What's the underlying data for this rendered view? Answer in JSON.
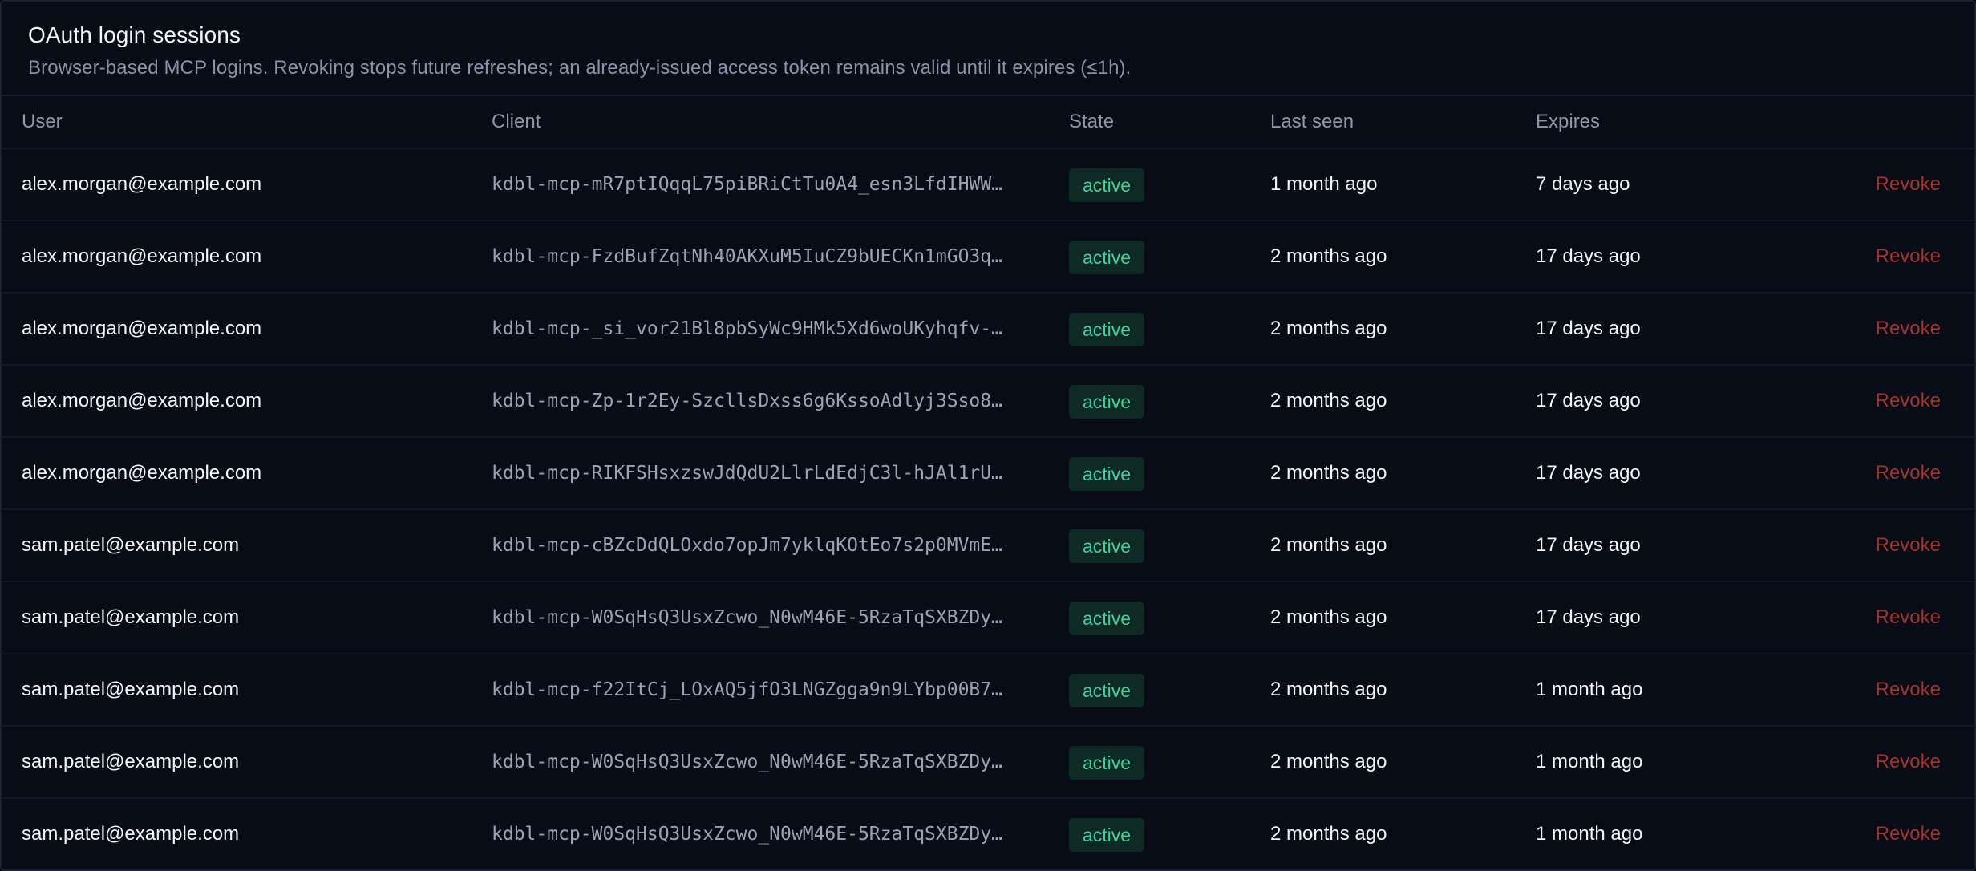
{
  "header": {
    "title": "OAuth login sessions",
    "subtitle": "Browser-based MCP logins. Revoking stops future refreshes; an already-issued access token remains valid until it expires (≤1h)."
  },
  "columns": {
    "user": "User",
    "client": "Client",
    "state": "State",
    "last_seen": "Last seen",
    "expires": "Expires"
  },
  "rows": [
    {
      "user": "alex.morgan@example.com",
      "client": "kdbl-mcp-mR7ptIQqqL75piBRiCtTu0A4_esn3LfdIHWW…",
      "state": "active",
      "last_seen": "1 month ago",
      "expires": "7 days ago",
      "action": "Revoke"
    },
    {
      "user": "alex.morgan@example.com",
      "client": "kdbl-mcp-FzdBufZqtNh40AKXuM5IuCZ9bUECKn1mGO3q…",
      "state": "active",
      "last_seen": "2 months ago",
      "expires": "17 days ago",
      "action": "Revoke"
    },
    {
      "user": "alex.morgan@example.com",
      "client": "kdbl-mcp-_si_vor21Bl8pbSyWc9HMk5Xd6woUKyhqfv-…",
      "state": "active",
      "last_seen": "2 months ago",
      "expires": "17 days ago",
      "action": "Revoke"
    },
    {
      "user": "alex.morgan@example.com",
      "client": "kdbl-mcp-Zp-1r2Ey-SzcllsDxss6g6KssoAdlyj3Sso8…",
      "state": "active",
      "last_seen": "2 months ago",
      "expires": "17 days ago",
      "action": "Revoke"
    },
    {
      "user": "alex.morgan@example.com",
      "client": "kdbl-mcp-RIKFSHsxzswJdQdU2LlrLdEdjC3l-hJAl1rU…",
      "state": "active",
      "last_seen": "2 months ago",
      "expires": "17 days ago",
      "action": "Revoke"
    },
    {
      "user": "sam.patel@example.com",
      "client": "kdbl-mcp-cBZcDdQLOxdo7opJm7yklqKOtEo7s2p0MVmE…",
      "state": "active",
      "last_seen": "2 months ago",
      "expires": "17 days ago",
      "action": "Revoke"
    },
    {
      "user": "sam.patel@example.com",
      "client": "kdbl-mcp-W0SqHsQ3UsxZcwo_N0wM46E-5RzaTqSXBZDy…",
      "state": "active",
      "last_seen": "2 months ago",
      "expires": "17 days ago",
      "action": "Revoke"
    },
    {
      "user": "sam.patel@example.com",
      "client": "kdbl-mcp-f22ItCj_LOxAQ5jfO3LNGZgga9n9LYbp00B7…",
      "state": "active",
      "last_seen": "2 months ago",
      "expires": "1 month ago",
      "action": "Revoke"
    },
    {
      "user": "sam.patel@example.com",
      "client": "kdbl-mcp-W0SqHsQ3UsxZcwo_N0wM46E-5RzaTqSXBZDy…",
      "state": "active",
      "last_seen": "2 months ago",
      "expires": "1 month ago",
      "action": "Revoke"
    },
    {
      "user": "sam.patel@example.com",
      "client": "kdbl-mcp-W0SqHsQ3UsxZcwo_N0wM46E-5RzaTqSXBZDy…",
      "state": "active",
      "last_seen": "2 months ago",
      "expires": "1 month ago",
      "action": "Revoke"
    }
  ],
  "colors": {
    "background": "#080c17",
    "badge_bg": "#0f2a25",
    "badge_text": "#3ed29a",
    "revoke": "#a3322f"
  }
}
